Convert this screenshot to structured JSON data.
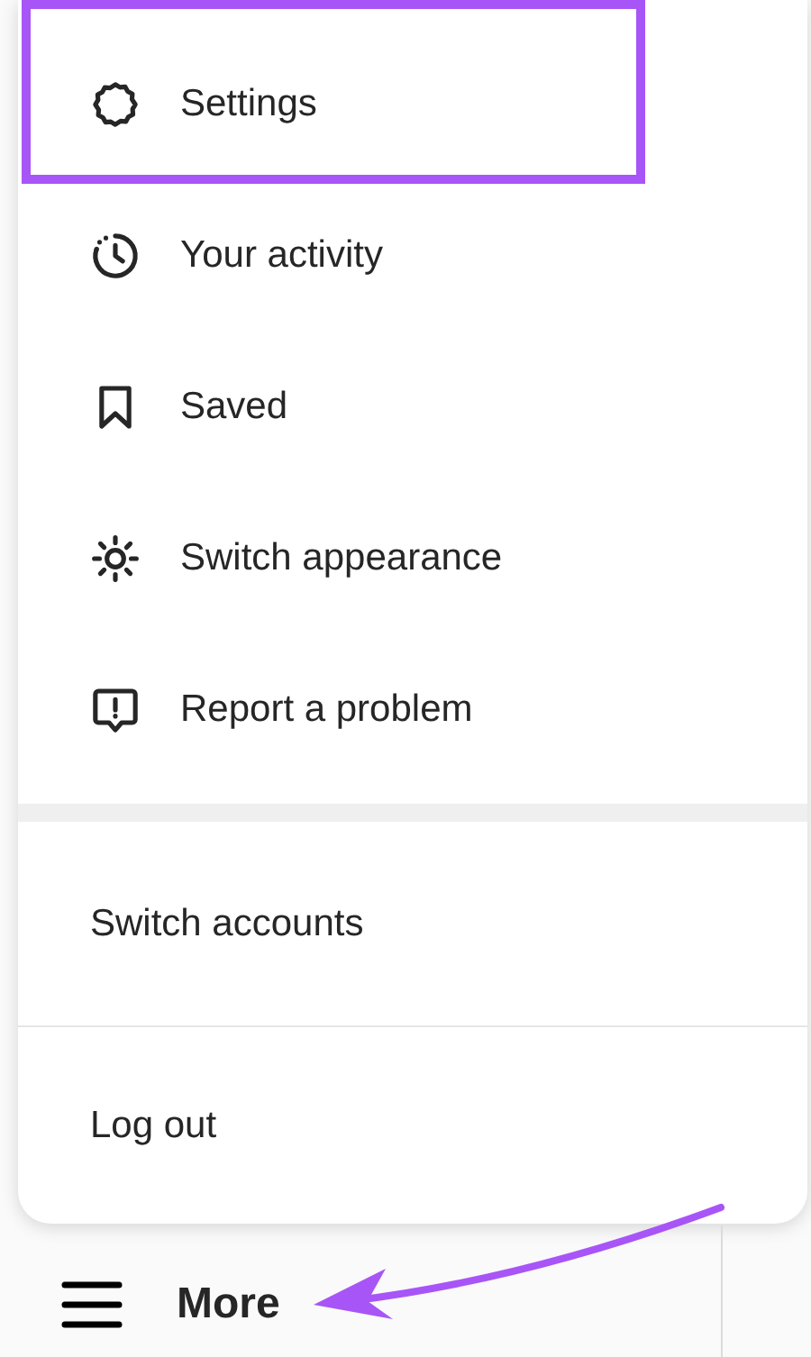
{
  "menu": {
    "items": [
      {
        "label": "Settings",
        "highlighted": true
      },
      {
        "label": "Your activity",
        "highlighted": false
      },
      {
        "label": "Saved",
        "highlighted": false
      },
      {
        "label": "Switch appearance",
        "highlighted": false
      },
      {
        "label": "Report a problem",
        "highlighted": false
      }
    ],
    "account_actions": [
      {
        "label": "Switch accounts"
      },
      {
        "label": "Log out"
      }
    ]
  },
  "nav": {
    "label": "More"
  }
}
